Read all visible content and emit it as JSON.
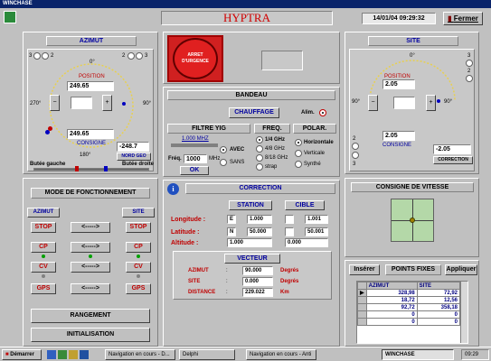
{
  "window": {
    "title": "WINCHASE"
  },
  "header": {
    "app_name": "HYPTRA",
    "datetime": "14/01/04 09:29:32",
    "close_label": "Fermer"
  },
  "azimut": {
    "title": "AZIMUT",
    "scale_left": "3",
    "scale_left2": "2",
    "scale_right": "2",
    "scale_right2": "3",
    "top_label": "0°",
    "left_deg": "270°",
    "right_deg": "90°",
    "bottom_deg": "180°",
    "position_label": "POSITION",
    "position_value": "249.65",
    "consigne_label": "CONSIGNE",
    "consigne_value": "249.65",
    "nord_value": "-248.7",
    "nord_label": "NORD GEO",
    "limit_left": "Butée gauche",
    "limit_right": "Butée droite"
  },
  "site": {
    "title": "SITE",
    "top_label": "0°",
    "left_deg": "90°",
    "right_deg": "90°",
    "scale_right1": "3",
    "scale_right2": "2",
    "scale_left1": "2",
    "scale_left2": "3",
    "position_label": "POSITION",
    "position_value": "2.05",
    "consigne_label": "CONSIGNE",
    "consigne_value": "2.05",
    "correction_value": "-2.05",
    "correction_label": "CORRECTION"
  },
  "arret": {
    "label": "ARRET D'URGENCE"
  },
  "bandeau": {
    "title": "BANDEAU",
    "chauffage": "CHAUFFAGE",
    "alim": "Alim.",
    "filtre_title": "FILTRE YIG",
    "filtre_value": "1.000 MHZ",
    "avec": "AVEC",
    "sans": "SANS",
    "freq_label": "Fréq.",
    "freq_value": "1000",
    "freq_unit": "MHz",
    "ok": "OK",
    "freq_title": "FREQ.",
    "f1": "1/4 GHz",
    "f2": "4/8 GHz",
    "f3": "8/18 GHz",
    "f4": "strap",
    "polar_title": "POLAR.",
    "p1": "Horizontale",
    "p2": "Verticale",
    "p3": "Synthé"
  },
  "correction": {
    "title": "CORRECTION",
    "station": "STATION",
    "cible": "CIBLE",
    "longitude": "Longitude :",
    "latitude": "Latitude :",
    "altitude": "Altitude :",
    "st_lon_dir": "E",
    "st_lon": "1.000",
    "st_lat_dir": "N",
    "st_lat": "50.000",
    "st_alt": "1.000",
    "ci_lon": "1.001",
    "ci_lat": "50.001",
    "ci_alt": "0.000",
    "vecteur": "VECTEUR",
    "azimut_lbl": "AZIMUT",
    "azimut_val": "90.000",
    "azimut_unit": "Degrés",
    "site_lbl": "SITE",
    "site_val": "0.000",
    "site_unit": "Degrés",
    "distance_lbl": "DISTANCE",
    "distance_val": "229.022",
    "distance_unit": "Km"
  },
  "mode": {
    "title": "MODE DE FONCTIONNEMENT",
    "col_az": "AZIMUT",
    "col_site": "SITE",
    "stop": "STOP",
    "cp": "CP",
    "cv": "CV",
    "gps": "GPS",
    "arrow": "<----->",
    "rangement": "RANGEMENT",
    "initialisation": "INITIALISATION"
  },
  "vitesse": {
    "title": "CONSIGNE DE VITESSE"
  },
  "points": {
    "inserer": "Insérer",
    "title": "POINTS FIXES",
    "appliquer": "Appliquer",
    "col_az": "AZIMUT",
    "col_site": "SITE",
    "rows": [
      [
        "328,98",
        "72,92"
      ],
      [
        "18,72",
        "12,56"
      ],
      [
        "92,72",
        "358,18"
      ],
      [
        "0",
        "0"
      ],
      [
        "0",
        "0"
      ]
    ]
  },
  "taskbar": {
    "start": "Démarrer",
    "t1": "Navigation en cours - D...",
    "t2": "Delphi",
    "t3": "Navigation en cours - Anti",
    "t4": "WINCHASE",
    "clock": "09:29"
  }
}
